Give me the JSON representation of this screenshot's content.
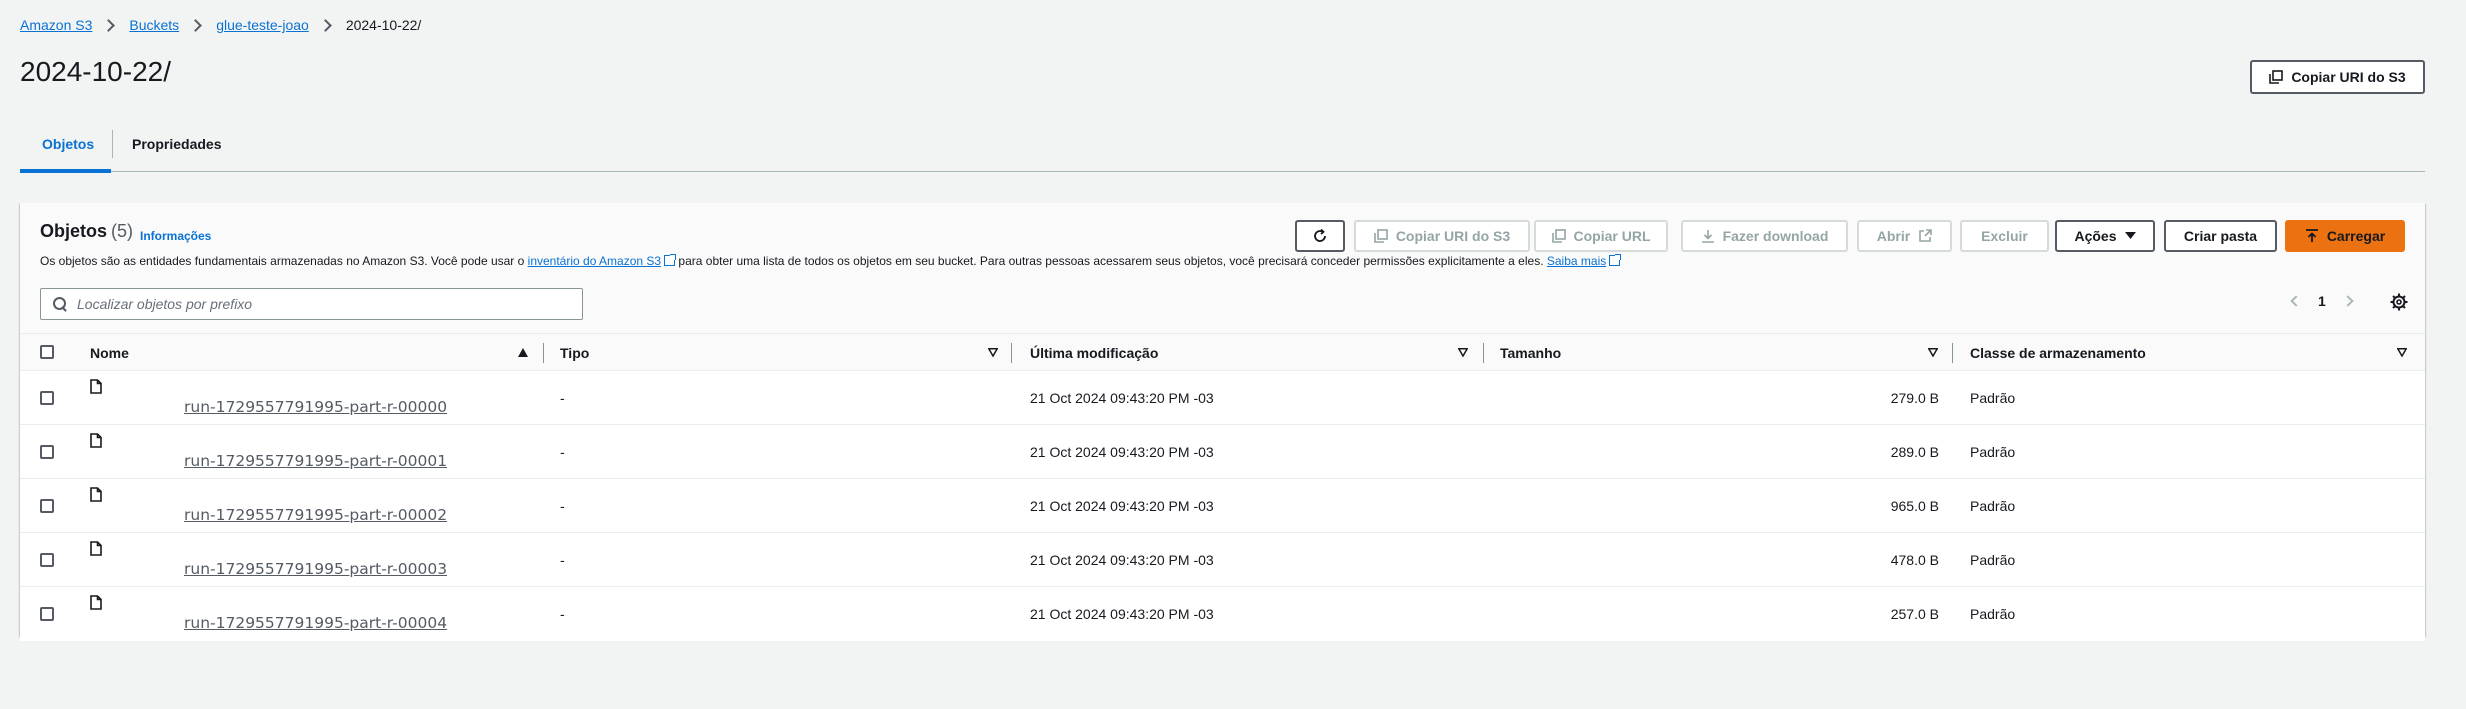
{
  "breadcrumb": {
    "items": [
      "Amazon S3",
      "Buckets",
      "glue-teste-joao"
    ],
    "current": "2024-10-22/"
  },
  "page": {
    "title": "2024-10-22/",
    "copy_uri_label": "Copiar URI do S3"
  },
  "tabs": [
    {
      "label": "Objetos",
      "active": true
    },
    {
      "label": "Propriedades",
      "active": false
    }
  ],
  "objects_panel": {
    "title": "Objetos",
    "count": "(5)",
    "info_link": "Informações",
    "description": {
      "part1": "Os objetos são as entidades fundamentais armazenadas no Amazon S3. Você pode usar o ",
      "link1": "inventário do Amazon S3",
      "part2": " para obter uma lista de todos os objetos em seu bucket. Para outras pessoas acessarem seus objetos, você precisará conceder permissões explicitamente a eles. ",
      "link2": "Saiba mais"
    },
    "toolbar": {
      "copy_uri": "Copiar URI do S3",
      "copy_url": "Copiar URL",
      "download": "Fazer download",
      "open": "Abrir",
      "delete": "Excluir",
      "actions": "Ações",
      "create_folder": "Criar pasta",
      "upload": "Carregar"
    },
    "search": {
      "placeholder": "Localizar objetos por prefixo",
      "value": ""
    },
    "pagination": {
      "current_page": "1"
    },
    "table": {
      "columns": [
        "Nome",
        "Tipo",
        "Última modificação",
        "Tamanho",
        "Classe de armazenamento"
      ],
      "rows": [
        {
          "name": "run-1729557791995-part-r-00000",
          "type": "-",
          "modified": "21 Oct 2024 09:43:20 PM -03",
          "size": "279.0 B",
          "storage": "Padrão"
        },
        {
          "name": "run-1729557791995-part-r-00001",
          "type": "-",
          "modified": "21 Oct 2024 09:43:20 PM -03",
          "size": "289.0 B",
          "storage": "Padrão"
        },
        {
          "name": "run-1729557791995-part-r-00002",
          "type": "-",
          "modified": "21 Oct 2024 09:43:20 PM -03",
          "size": "965.0 B",
          "storage": "Padrão"
        },
        {
          "name": "run-1729557791995-part-r-00003",
          "type": "-",
          "modified": "21 Oct 2024 09:43:20 PM -03",
          "size": "478.0 B",
          "storage": "Padrão"
        },
        {
          "name": "run-1729557791995-part-r-00004",
          "type": "-",
          "modified": "21 Oct 2024 09:43:20 PM -03",
          "size": "257.0 B",
          "storage": "Padrão"
        }
      ]
    }
  },
  "colors": {
    "link": "#0972d3",
    "primary_button": "#ec7211",
    "background": "#f2f3f3"
  }
}
